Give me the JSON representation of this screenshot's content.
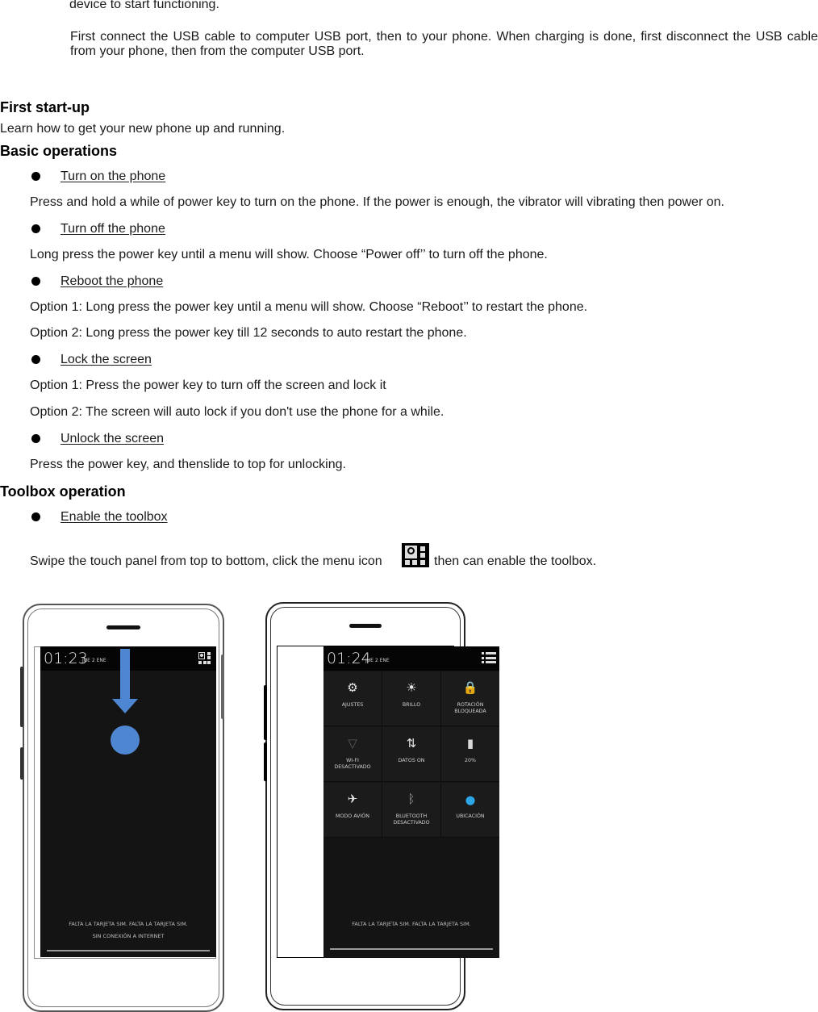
{
  "document": {
    "intro_tail": "device to start functioning.",
    "usb_paragraph": "First connect the USB cable to computer USB port, then to your phone. When charging   is done, first disconnect the USB cable from your phone, then from the computer USB port.",
    "sections": {
      "first_startup": {
        "heading": "First start-up",
        "description": "Learn how to get your new phone up and running."
      },
      "basic_operations": {
        "heading": "Basic operations",
        "items": [
          {
            "title": "Turn on the phone",
            "lines": [
              "Press and hold a while of power key to turn on the phone. If the power is enough, the vibrator will vibrating then power on."
            ]
          },
          {
            "title": "Turn off the phone",
            "lines": [
              "Long press the power key until a menu will show. Choose “Power off’’ to turn off the phone."
            ]
          },
          {
            "title": "Reboot the phone",
            "lines": [
              "Option 1: Long press the power key until a menu will show. Choose “Reboot’’ to restart the phone.",
              "Option 2: Long press the power key till 12 seconds to auto restart the phone."
            ]
          },
          {
            "title": "Lock the screen",
            "lines": [
              "Option 1: Press the power key to turn off the screen and lock it",
              "Option 2: The screen will auto lock if you don't use the phone for a while."
            ]
          },
          {
            "title": "Unlock the screen",
            "lines": [
              "Press the power key, and thenslide to top for unlocking."
            ]
          }
        ]
      },
      "toolbox_operation": {
        "heading": "Toolbox operation",
        "items": [
          {
            "title": "Enable the toolbox"
          }
        ],
        "instruction_before_icon": "Swipe the touch panel from top to bottom, click the menu icon",
        "instruction_icon": "quick-settings-menu-icon",
        "instruction_after_icon": "then can enable the toolbox."
      }
    }
  },
  "figures": {
    "accent_color": "#4f86d1",
    "phone_left": {
      "time": "01:23",
      "date": "JUE 2 ENE",
      "status_icon": "quick-settings-menu-icon",
      "gesture": "swipe-down-arrow",
      "bottom_lines": [
        "FALTA LA TARJETA SIM.    FALTA LA TARJETA SIM.",
        "SIN CONEXIÓN A INTERNET"
      ]
    },
    "phone_right": {
      "time": "01:24",
      "date": "JUE 2 ENE",
      "status_icon": "list-view-icon",
      "tiles": [
        {
          "icon": "gear-icon",
          "glyph": "⚙",
          "label": "AJUSTES",
          "color": "#e8e8e8"
        },
        {
          "icon": "brightness-icon",
          "glyph": "☀",
          "label": "BRILLO",
          "color": "#e8e8e8"
        },
        {
          "icon": "rotation-lock-icon",
          "glyph": "🔒",
          "label": "ROTACIÓN\nBLOQUEADA",
          "color": "#e8e8e8"
        },
        {
          "icon": "wifi-icon",
          "glyph": "▽",
          "label": "WI-FI\nDESACTIVADO",
          "color": "#5a5a5a"
        },
        {
          "icon": "data-arrows-icon",
          "glyph": "⇅",
          "label": "DATOS ON",
          "color": "#e8e8e8"
        },
        {
          "icon": "battery-icon",
          "glyph": "▮",
          "label": "20%",
          "color": "#d8d8d8"
        },
        {
          "icon": "airplane-icon",
          "glyph": "✈",
          "label": "MODO AVIÓN",
          "color": "#e8e8e8"
        },
        {
          "icon": "bluetooth-icon",
          "glyph": "ᛒ",
          "label": "BLUETOOTH\nDESACTIVADO",
          "color": "#9a9a9a"
        },
        {
          "icon": "location-pin-icon",
          "glyph": "⬤",
          "label": "UBICACIÓN",
          "color": "#2ea6e6"
        }
      ],
      "bottom_lines": [
        "FALTA LA TARJETA SIM.    FALTA LA TARJETA SIM."
      ]
    }
  }
}
